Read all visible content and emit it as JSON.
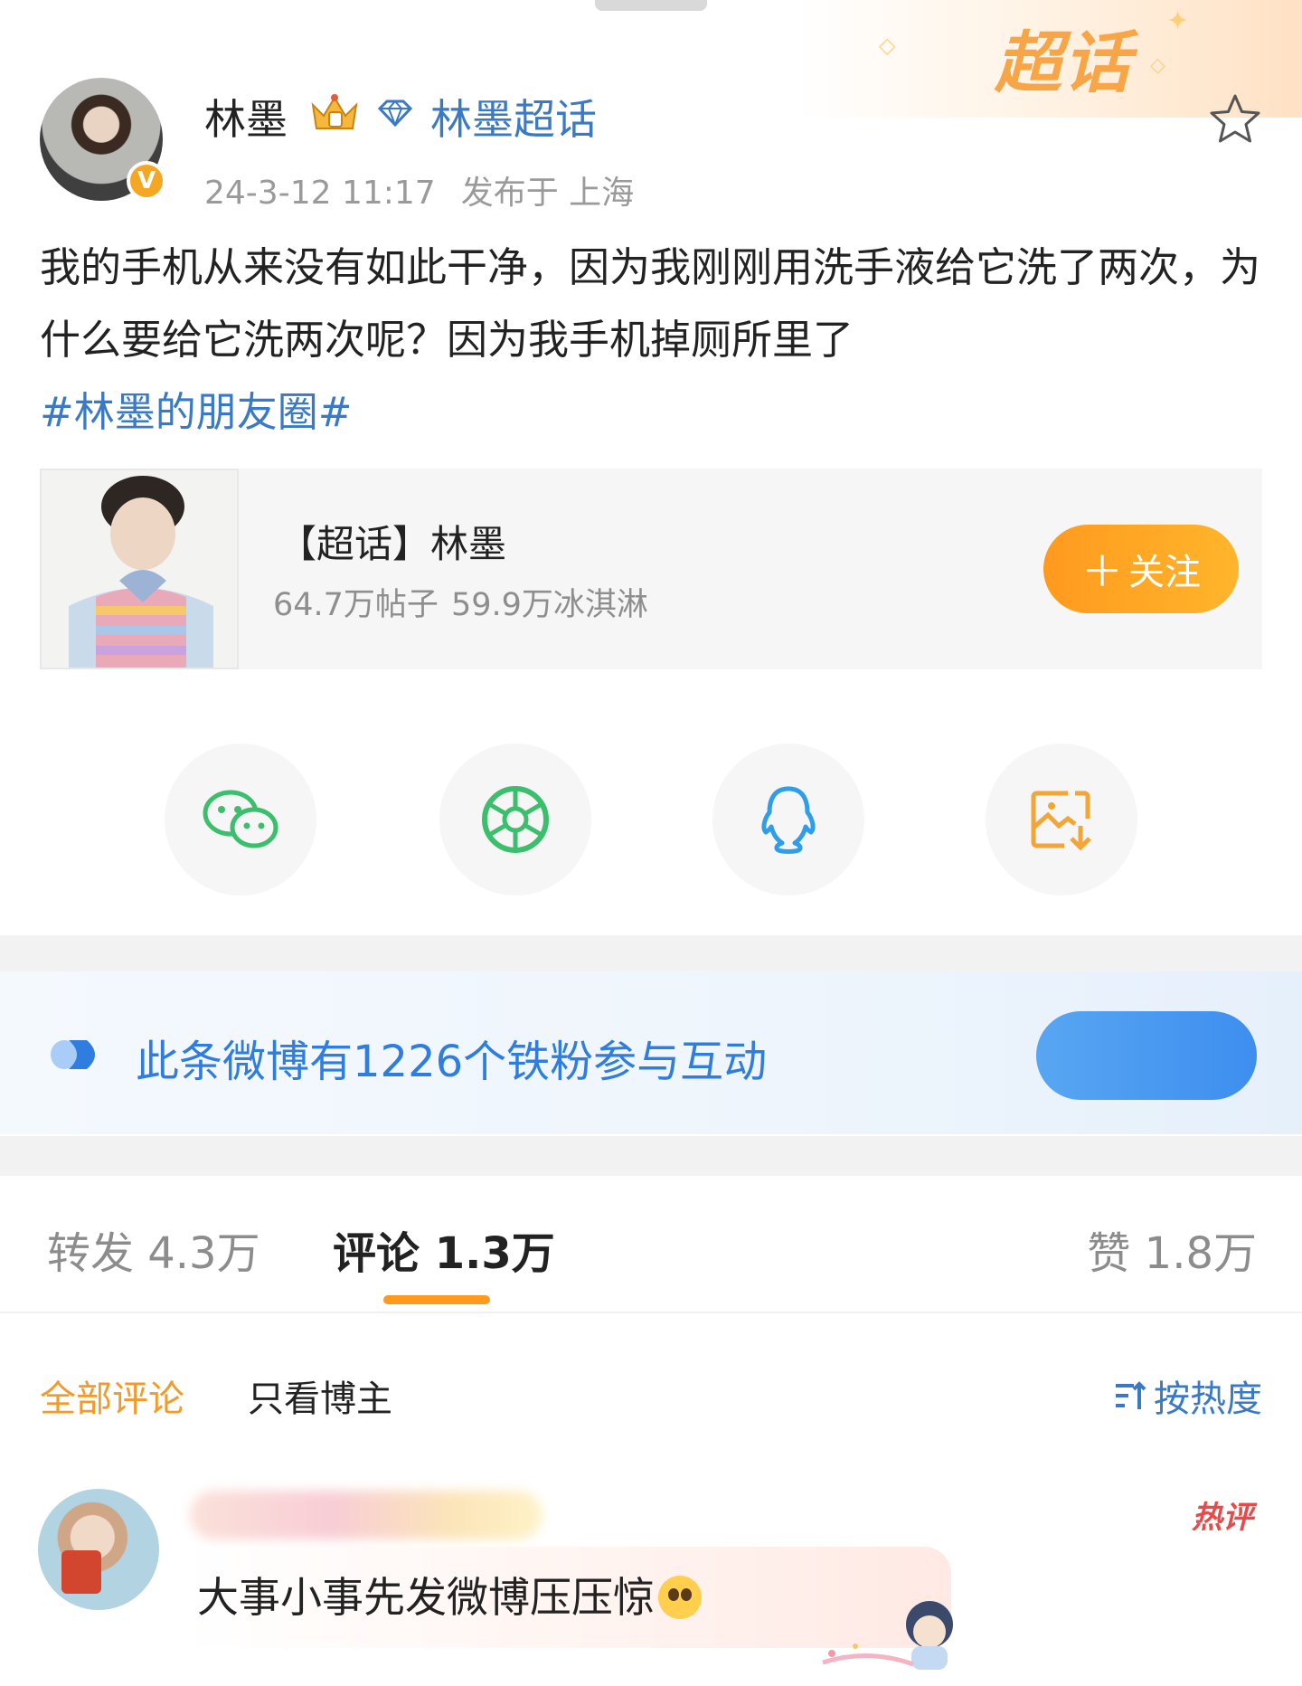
{
  "watermark": {
    "text": "超话"
  },
  "author": {
    "name": "林墨",
    "verified_badge": "V",
    "supertopic_link": "林墨超话",
    "timestamp": "24-3-12 11:17",
    "location": "发布于 上海"
  },
  "post": {
    "text": "我的手机从来没有如此干净，因为我刚刚用洗手液给它洗了两次，为什么要给它洗两次呢？因为我手机掉厕所里了",
    "hashtag": "#林墨的朋友圈#"
  },
  "supertopic_card": {
    "title": "【超话】林墨",
    "posts_count": "64.7万帖子",
    "icecream_count": "59.9万冰淇淋",
    "follow_label": "关注"
  },
  "share": {
    "icons": [
      "wechat-icon",
      "moments-icon",
      "qq-icon",
      "save-image-icon"
    ]
  },
  "ironfan": {
    "text": "此条微博有1226个铁粉参与互动"
  },
  "tabs": {
    "repost": "转发 4.3万",
    "comments": "评论 1.3万",
    "likes": "赞 1.8万"
  },
  "filters": {
    "all": "全部评论",
    "owner_only": "只看博主",
    "sort": "按热度"
  },
  "comment": {
    "hot_badge": "热评",
    "text": "大事小事先发微博压压惊"
  },
  "colors": {
    "accent_orange": "#ff9a1e",
    "link_blue": "#3a79c6",
    "ironfan_blue": "#2f7de0",
    "hot_red": "#e84a4a"
  }
}
